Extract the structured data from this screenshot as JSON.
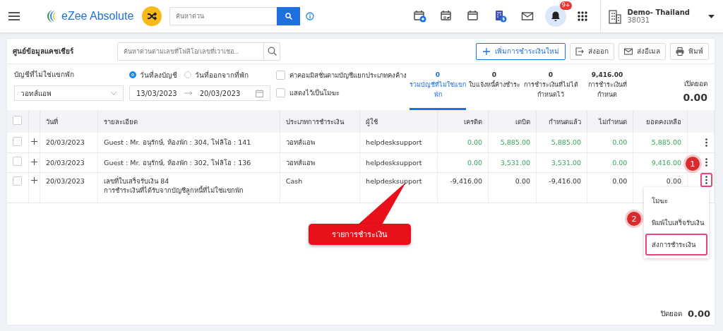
{
  "topbar": {
    "brand": "eZee Absolute",
    "search": {
      "placeholder": "ค้นหาด่วน"
    },
    "notifications_badge": "9+",
    "property": {
      "name": "Demo- Thailand",
      "code": "38031"
    }
  },
  "panel": {
    "title": "ศูนย์ข้อมูลแคชเชียร์",
    "search": {
      "placeholder": "ค้นหาด่วนตามเลขที่โฟลิโอ/เลขที่เวาเชอ..."
    },
    "buttons": [
      {
        "kind": "add",
        "label": "เพิ่มการชำระเงินใหม่"
      },
      {
        "kind": "export",
        "label": "ส่งออก"
      },
      {
        "kind": "email",
        "label": "ส่งอีเมล"
      },
      {
        "kind": "print",
        "label": "พิมพ์"
      }
    ]
  },
  "filters": {
    "account_label": "บัญชีที่ไม่ใช่แขกพัก",
    "account_value": "วอทส์แอพ",
    "date_modes": [
      {
        "label": "วันที่ลงบัญชี",
        "selected": true
      },
      {
        "label": "วันที่ออกจากที่พัก",
        "selected": false
      }
    ],
    "date_from": "13/03/2023",
    "date_to": "20/03/2023",
    "options": [
      {
        "label": "ค่าคอมมิสชั่นตามบัญชีแยกประเภทคงค้าง",
        "checked": false
      },
      {
        "label": "แสดงไว้เป็นโมฆะ",
        "checked": false
      }
    ]
  },
  "summary_tabs": [
    {
      "value": "0",
      "label": "รวมบัญชีที่ไม่ใช่แขกพัก",
      "selected": true
    },
    {
      "value": "0",
      "label": "ใบแจ้งหนี้ค้างชำระ",
      "selected": false
    },
    {
      "value": "0",
      "label": "การชำระเงินที่ไม่ได้กำหนดไว้",
      "selected": false
    },
    {
      "value": "9,416.00",
      "label": "การชำระเงินที่กำหนด",
      "selected": false
    }
  ],
  "opening": {
    "label": "เปิดยอด",
    "value": "0.00"
  },
  "table": {
    "all_checked": false,
    "columns": [
      "วันที่",
      "รายละเอียด",
      "ประเภทการชำระเงิน",
      "ผู้ใช้",
      "เครดิต",
      "เดบิต",
      "กำหนดแล้ว",
      "ไม่กำหนด",
      "ยอดคงเหลือ"
    ],
    "rows": [
      {
        "checked": false,
        "date": "20/03/2023",
        "details": [
          "Guest : Mr. อนุรักษ์, ห้องพัก : 304, โฟลิโอ : 141"
        ],
        "type": "วอทส์แอพ",
        "user": "helpdesksupport",
        "amounts": [
          "0.00",
          "5,885.00",
          "5,885.00",
          "0.00",
          "5,885.00"
        ],
        "amounts_green": true,
        "menu_open": false
      },
      {
        "checked": false,
        "date": "20/03/2023",
        "details": [
          "Guest : Mr. อนุรักษ์, ห้องพัก : 302, โฟลิโอ : 136"
        ],
        "type": "วอทส์แอพ",
        "user": "helpdesksupport",
        "amounts": [
          "0.00",
          "3,531.00",
          "3,531.00",
          "0.00",
          "9,416.00"
        ],
        "amounts_green": true,
        "menu_open": false
      },
      {
        "checked": false,
        "date": "20/03/2023",
        "details": [
          "เลขที่ใบเสร็จรับเงิน 84",
          "การชำระเงินที่ได้รับจากบัญชีลูกหนี้ที่ไม่ใช่แขกพัก"
        ],
        "type": "Cash",
        "user": "helpdesksupport",
        "amounts": [
          "-9,416.00",
          "0.00",
          "-9,416.00",
          "0.00",
          "0.00"
        ],
        "amounts_green": false,
        "menu_open": true
      }
    ]
  },
  "row_menu": [
    {
      "label": "โมฆะ",
      "selected": false
    },
    {
      "label": "พิมพ์ใบเสร็จรับเงิน",
      "selected": false
    },
    {
      "label": "ส่งการชำระเงิน",
      "selected": true
    }
  ],
  "annotations": {
    "markers": [
      "1",
      "2"
    ],
    "callout": "รายการชำระเงิน"
  },
  "footer": {
    "label": "ปิดยอด",
    "value": "0.00"
  }
}
